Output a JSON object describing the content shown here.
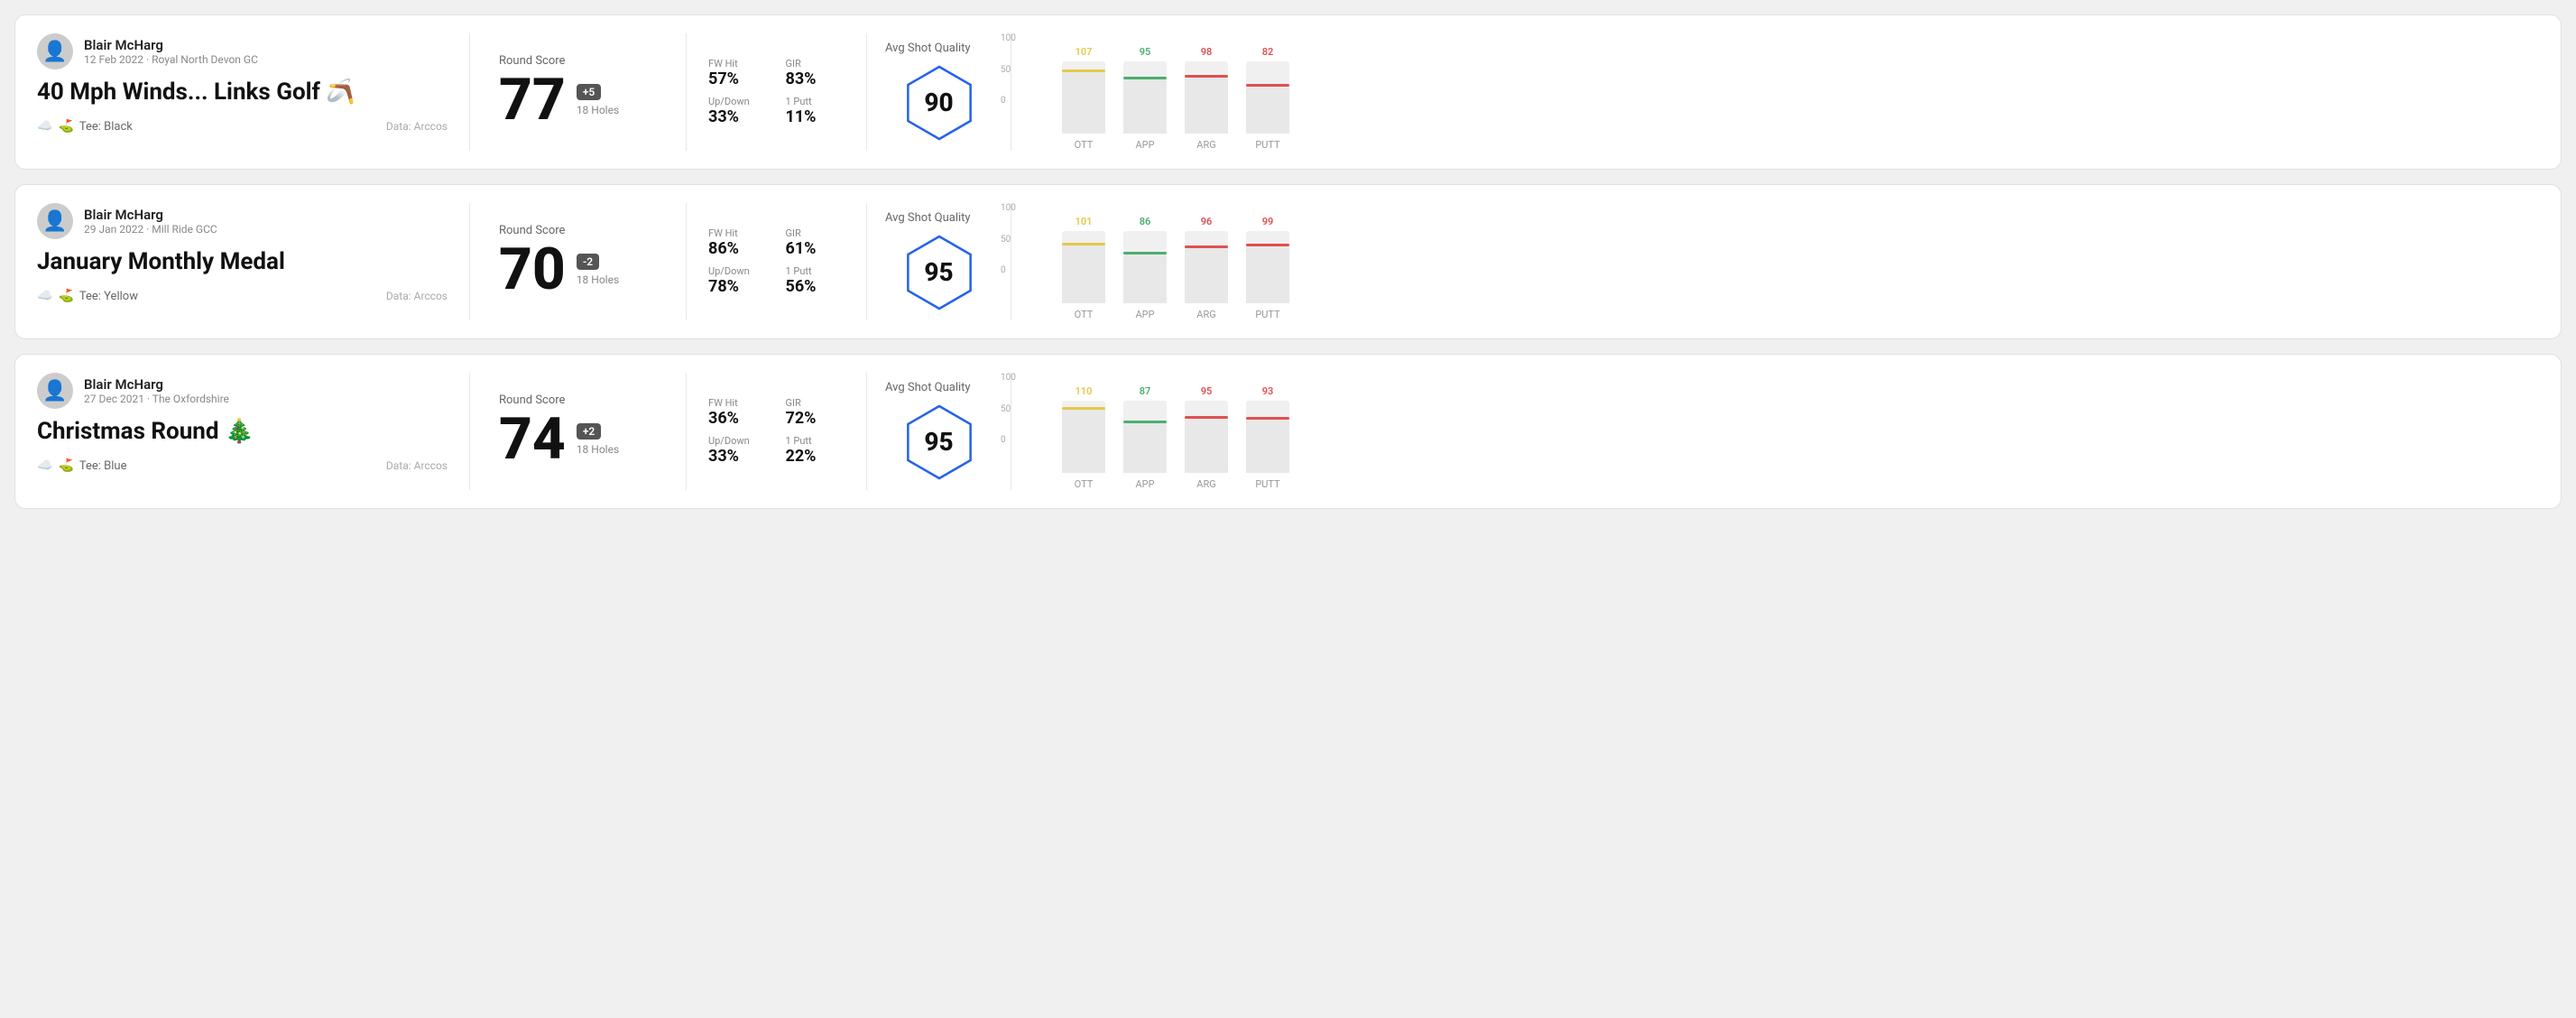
{
  "rounds": [
    {
      "id": "round1",
      "user": {
        "name": "Blair McHarg",
        "date": "12 Feb 2022",
        "course": "Royal North Devon GC"
      },
      "title": "40 Mph Winds... Links Golf 🪃",
      "tee": "Black",
      "data_source": "Data: Arccos",
      "round_score_label": "Round Score",
      "score": "77",
      "badge": "+5",
      "holes": "18 Holes",
      "fw_hit_label": "FW Hit",
      "fw_hit": "57%",
      "gir_label": "GIR",
      "gir": "83%",
      "updown_label": "Up/Down",
      "updown": "33%",
      "oneputt_label": "1 Putt",
      "oneputt": "11%",
      "avg_shot_label": "Avg Shot Quality",
      "shot_quality": "90",
      "chart": {
        "ott": {
          "val": 107,
          "color": "#e6c84a"
        },
        "app": {
          "val": 95,
          "color": "#4caf6e"
        },
        "arg": {
          "val": 98,
          "color": "#e05050"
        },
        "putt": {
          "val": 82,
          "color": "#e05050"
        }
      }
    },
    {
      "id": "round2",
      "user": {
        "name": "Blair McHarg",
        "date": "29 Jan 2022",
        "course": "Mill Ride GCC"
      },
      "title": "January Monthly Medal",
      "tee": "Yellow",
      "data_source": "Data: Arccos",
      "round_score_label": "Round Score",
      "score": "70",
      "badge": "-2",
      "holes": "18 Holes",
      "fw_hit_label": "FW Hit",
      "fw_hit": "86%",
      "gir_label": "GIR",
      "gir": "61%",
      "updown_label": "Up/Down",
      "updown": "78%",
      "oneputt_label": "1 Putt",
      "oneputt": "56%",
      "avg_shot_label": "Avg Shot Quality",
      "shot_quality": "95",
      "chart": {
        "ott": {
          "val": 101,
          "color": "#e6c84a"
        },
        "app": {
          "val": 86,
          "color": "#4caf6e"
        },
        "arg": {
          "val": 96,
          "color": "#e05050"
        },
        "putt": {
          "val": 99,
          "color": "#e05050"
        }
      }
    },
    {
      "id": "round3",
      "user": {
        "name": "Blair McHarg",
        "date": "27 Dec 2021",
        "course": "The Oxfordshire"
      },
      "title": "Christmas Round 🎄",
      "tee": "Blue",
      "data_source": "Data: Arccos",
      "round_score_label": "Round Score",
      "score": "74",
      "badge": "+2",
      "holes": "18 Holes",
      "fw_hit_label": "FW Hit",
      "fw_hit": "36%",
      "gir_label": "GIR",
      "gir": "72%",
      "updown_label": "Up/Down",
      "updown": "33%",
      "oneputt_label": "1 Putt",
      "oneputt": "22%",
      "avg_shot_label": "Avg Shot Quality",
      "shot_quality": "95",
      "chart": {
        "ott": {
          "val": 110,
          "color": "#e6c84a"
        },
        "app": {
          "val": 87,
          "color": "#4caf6e"
        },
        "arg": {
          "val": 95,
          "color": "#e05050"
        },
        "putt": {
          "val": 93,
          "color": "#e05050"
        }
      }
    }
  ],
  "labels": {
    "y_100": "100",
    "y_50": "50",
    "y_0": "0",
    "ott": "OTT",
    "app": "APP",
    "arg": "ARG",
    "putt": "PUTT"
  }
}
